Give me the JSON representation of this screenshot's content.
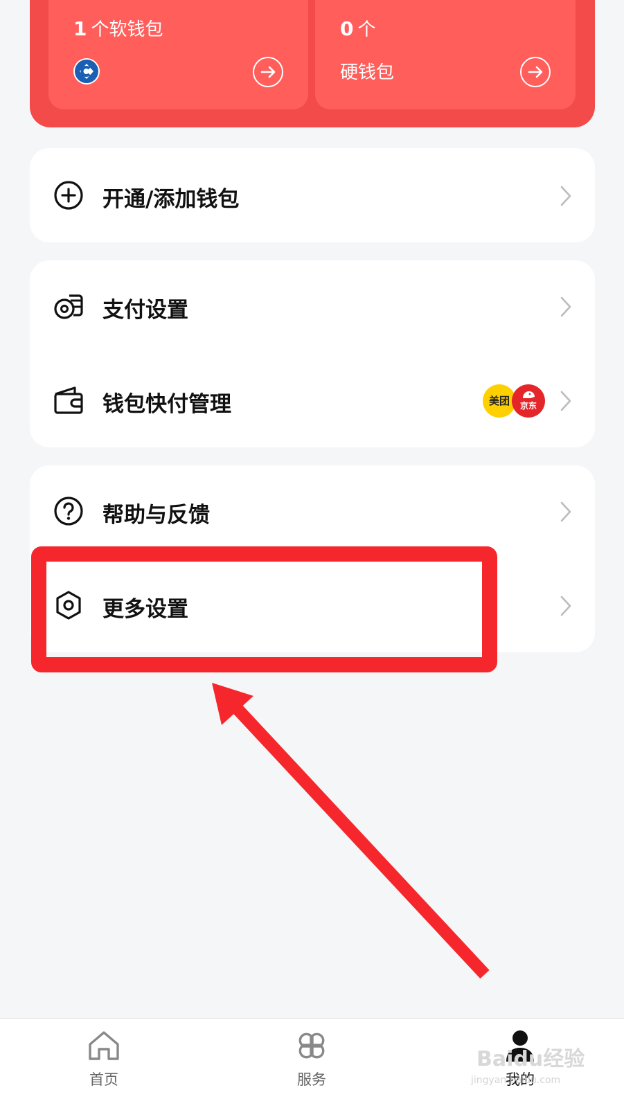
{
  "wallets": {
    "soft": {
      "count": "1",
      "unit": "个软钱包",
      "icon": "bank-logo"
    },
    "hard": {
      "count": "0",
      "unit": "个",
      "label": "硬钱包"
    }
  },
  "menu": {
    "add_wallet": {
      "label": "开通/添加钱包",
      "icon": "plus-circle-icon"
    },
    "pay_settings": {
      "label": "支付设置",
      "icon": "coins-icon"
    },
    "quick_pay": {
      "label": "钱包快付管理",
      "icon": "wallet-icon",
      "badges": [
        {
          "name": "meituan",
          "text": "美团"
        },
        {
          "name": "jd",
          "text": "京东"
        }
      ]
    },
    "help": {
      "label": "帮助与反馈",
      "icon": "question-circle-icon"
    },
    "more_settings": {
      "label": "更多设置",
      "icon": "hexagon-settings-icon"
    }
  },
  "tabs": [
    {
      "label": "首页",
      "icon": "home-icon"
    },
    {
      "label": "服务",
      "icon": "grid-icon"
    },
    {
      "label": "我的",
      "icon": "person-icon",
      "active": true
    }
  ],
  "watermark": {
    "text": "Baidu经验",
    "url": "jingyan.baidu.com"
  },
  "colors": {
    "card_red": "#f34a4a",
    "tile_red": "#ff5e5b",
    "annotation_red": "#f5272c",
    "background": "#f5f6f8"
  }
}
